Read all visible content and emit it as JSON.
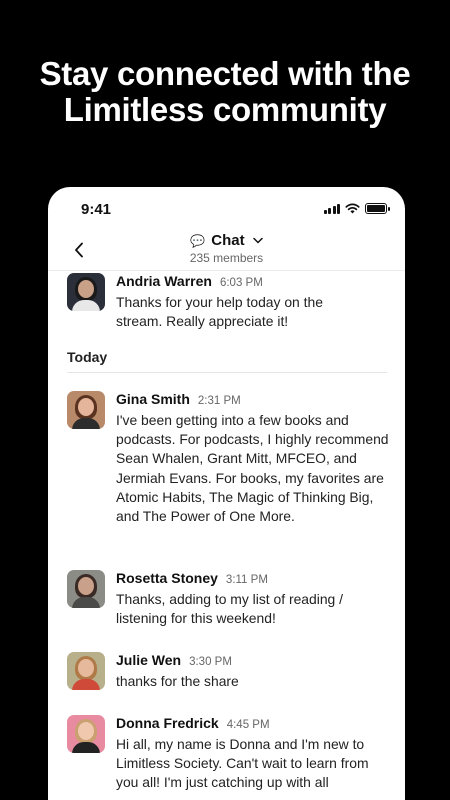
{
  "promo": {
    "headline_line1": "Stay connected with the",
    "headline_line2": "Limitless community"
  },
  "status_bar": {
    "time": "9:41"
  },
  "nav": {
    "title": "Chat",
    "subtitle": "235 members",
    "icons": {
      "back": "chevron-left-icon",
      "channel": "speech-bubble-icon",
      "dropdown": "chevron-down-icon"
    }
  },
  "day_divider": "Today",
  "messages": [
    {
      "name": "Andria Warren",
      "time": "6:03 PM",
      "text": "Thanks for your help today on the stream. Really appreciate it!"
    },
    {
      "name": "Gina Smith",
      "time": "2:31 PM",
      "text": "I've been getting into a few books and podcasts. For podcasts, I highly recommend Sean Whalen, Grant Mitt, MFCEO, and Jermiah Evans. For books, my favorites are Atomic Habits, The Magic of Thinking Big, and The Power of One More."
    },
    {
      "name": "Rosetta Stoney",
      "time": "3:11 PM",
      "text": "Thanks, adding to my list of reading / listening for this weekend!"
    },
    {
      "name": "Julie Wen",
      "time": "3:30 PM",
      "text": "thanks for the share"
    },
    {
      "name": "Donna Fredrick",
      "time": "4:45 PM",
      "text": "Hi all, my name is Donna and I'm new to Limitless Society. Can't wait to learn from you all! I'm just catching up with all"
    }
  ],
  "colors": {
    "background": "#000000",
    "card": "#ffffff",
    "text": "#111111",
    "muted": "#666666"
  }
}
